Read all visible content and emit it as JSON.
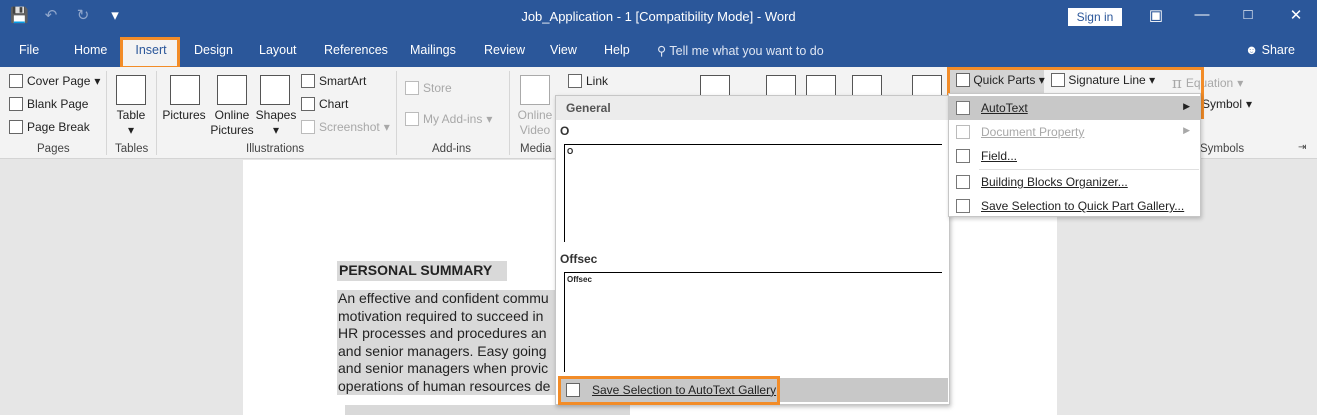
{
  "titlebar": {
    "title": "Job_Application - 1 [Compatibility Mode]  -  Word",
    "signin": "Sign in",
    "save_icon": "💾",
    "undo_icon": "↶",
    "redo_icon": "↻",
    "customize_icon": "▾",
    "ribbon_display_icon": "▣",
    "minimize_icon": "—",
    "maximize_icon": "□",
    "close_icon": "✕"
  },
  "tabs": [
    "File",
    "Home",
    "Insert",
    "Design",
    "Layout",
    "References",
    "Mailings",
    "Review",
    "View",
    "Help"
  ],
  "tellme": "Tell me what you want to do",
  "share": "Share",
  "ribbon": {
    "pages": {
      "cover": "Cover Page",
      "blank": "Blank Page",
      "break": "Page Break",
      "label": "Pages"
    },
    "tables": {
      "table": "Table",
      "label": "Tables"
    },
    "illustrations": {
      "pictures": "Pictures",
      "online1": "Online",
      "online2": "Pictures",
      "shapes": "Shapes",
      "smartart": "SmartArt",
      "chart": "Chart",
      "screenshot": "Screenshot",
      "label": "Illustrations"
    },
    "addins": {
      "store": "Store",
      "myaddins": "My Add-ins",
      "label": "Add-ins"
    },
    "media": {
      "online1": "Online",
      "video": "Video",
      "label": "Media"
    },
    "links": {
      "link": "Link"
    },
    "quickparts": "Quick Parts",
    "signature": "Signature Line",
    "equation": "Equation",
    "symbol": "Symbol",
    "symbols_label": "Symbols"
  },
  "gallery": {
    "header": "General",
    "items": [
      {
        "name": "O",
        "preview": "O"
      },
      {
        "name": "Offsec",
        "preview": "Offsec"
      }
    ],
    "footer": "Save Selection to AutoText Gallery"
  },
  "qpmenu": {
    "items": [
      {
        "label": "AutoText"
      },
      {
        "label": "Document Property"
      },
      {
        "label": "Field..."
      },
      {
        "label": "Building Blocks Organizer..."
      },
      {
        "label": "Save Selection to Quick Part Gallery..."
      }
    ]
  },
  "document": {
    "heading": "PERSONAL SUMMARY",
    "lines": [
      "An effective and confident commu",
      "motivation required to succeed in",
      "HR processes and procedures an",
      "and senior managers. Easy going",
      "and senior managers when provic",
      "operations of human resources de"
    ]
  }
}
